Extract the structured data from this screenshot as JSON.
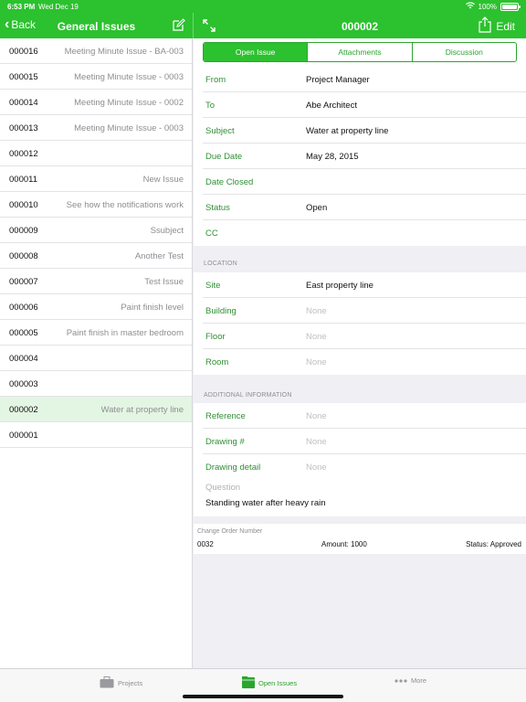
{
  "status_bar": {
    "time": "6:53 PM",
    "date": "Wed Dec 19",
    "battery": "100%"
  },
  "left_nav": {
    "back_label": "Back",
    "title": "General Issues"
  },
  "right_nav": {
    "title": "000002",
    "edit_label": "Edit"
  },
  "issues": [
    {
      "number": "000016",
      "title": "Meeting Minute Issue - BA-003"
    },
    {
      "number": "000015",
      "title": "Meeting Minute Issue - 0003"
    },
    {
      "number": "000014",
      "title": "Meeting Minute Issue - 0002"
    },
    {
      "number": "000013",
      "title": "Meeting Minute Issue - 0003"
    },
    {
      "number": "000012",
      "title": ""
    },
    {
      "number": "000011",
      "title": "New Issue"
    },
    {
      "number": "000010",
      "title": "See how the notifications work"
    },
    {
      "number": "000009",
      "title": "Ssubject"
    },
    {
      "number": "000008",
      "title": "Another Test"
    },
    {
      "number": "000007",
      "title": "Test Issue"
    },
    {
      "number": "000006",
      "title": "Paint finish level"
    },
    {
      "number": "000005",
      "title": "Paint finish in master bedroom"
    },
    {
      "number": "000004",
      "title": ""
    },
    {
      "number": "000003",
      "title": ""
    },
    {
      "number": "000002",
      "title": "Water at property line"
    },
    {
      "number": "000001",
      "title": ""
    }
  ],
  "segments": [
    "Open Issue",
    "Attachments",
    "Discussion"
  ],
  "details": [
    {
      "label": "From",
      "value": "Project Manager"
    },
    {
      "label": "To",
      "value": "Abe Architect"
    },
    {
      "label": "Subject",
      "value": "Water at property line"
    },
    {
      "label": "Due Date",
      "value": "May 28, 2015"
    },
    {
      "label": "Date Closed",
      "value": ""
    },
    {
      "label": "Status",
      "value": "Open"
    },
    {
      "label": "CC",
      "value": ""
    }
  ],
  "location": {
    "header": "LOCATION",
    "fields": [
      {
        "label": "Site",
        "value": "East property line"
      },
      {
        "label": "Building",
        "value": "None"
      },
      {
        "label": "Floor",
        "value": "None"
      },
      {
        "label": "Room",
        "value": "None"
      }
    ]
  },
  "additional": {
    "header": "ADDITIONAL INFORMATION",
    "fields": [
      {
        "label": "Reference",
        "value": "None"
      },
      {
        "label": "Drawing #",
        "value": "None"
      },
      {
        "label": "Drawing detail",
        "value": "None"
      }
    ],
    "question_label": "Question",
    "question_value": "Standing water after heavy rain"
  },
  "change_order": {
    "label": "Change Order Number",
    "number": "0032",
    "amount": "Amount: 1000",
    "status": "Status: Approved"
  },
  "tabs": [
    {
      "label": "Projects",
      "icon": "briefcase-icon"
    },
    {
      "label": "Open Issues",
      "icon": "folder-icon"
    },
    {
      "label": "More",
      "icon": "more-dots-icon"
    }
  ],
  "colors": {
    "accent": "#2cc12f",
    "label_green": "#2f8f35",
    "selected_row": "#e3f5e3"
  }
}
